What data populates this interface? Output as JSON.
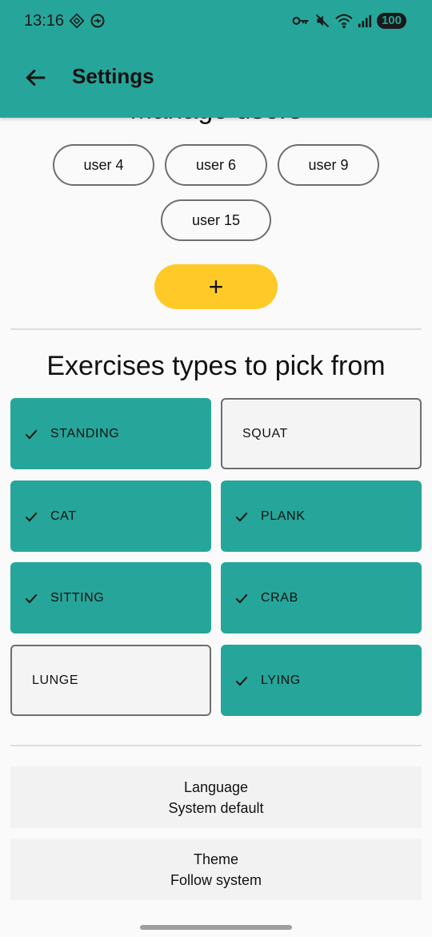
{
  "status_bar": {
    "time": "13:16",
    "battery": "100",
    "left_icons": [
      "sync-icon",
      "data-saver-icon"
    ],
    "right_icons": [
      "vpn-key-icon",
      "mute-icon",
      "wifi-icon",
      "signal-icon"
    ]
  },
  "app_bar": {
    "title": "Settings",
    "back_icon": "arrow-back-icon"
  },
  "manage_users": {
    "title": "Manage users",
    "users": [
      "user 4",
      "user 6",
      "user 9",
      "user 15"
    ],
    "add_label": "+"
  },
  "exercises": {
    "title": "Exercises types to pick from",
    "items": [
      {
        "label": "STANDING",
        "selected": true
      },
      {
        "label": "SQUAT",
        "selected": false
      },
      {
        "label": "CAT",
        "selected": true
      },
      {
        "label": "PLANK",
        "selected": true
      },
      {
        "label": "SITTING",
        "selected": true
      },
      {
        "label": "CRAB",
        "selected": true
      },
      {
        "label": "LUNGE",
        "selected": false
      },
      {
        "label": "LYING",
        "selected": true
      }
    ]
  },
  "preferences": {
    "language": {
      "label": "Language",
      "value": "System default"
    },
    "theme": {
      "label": "Theme",
      "value": "Follow system"
    }
  },
  "colors": {
    "primary": "#26a69a",
    "accent": "#ffca28",
    "background": "#fafafa"
  }
}
